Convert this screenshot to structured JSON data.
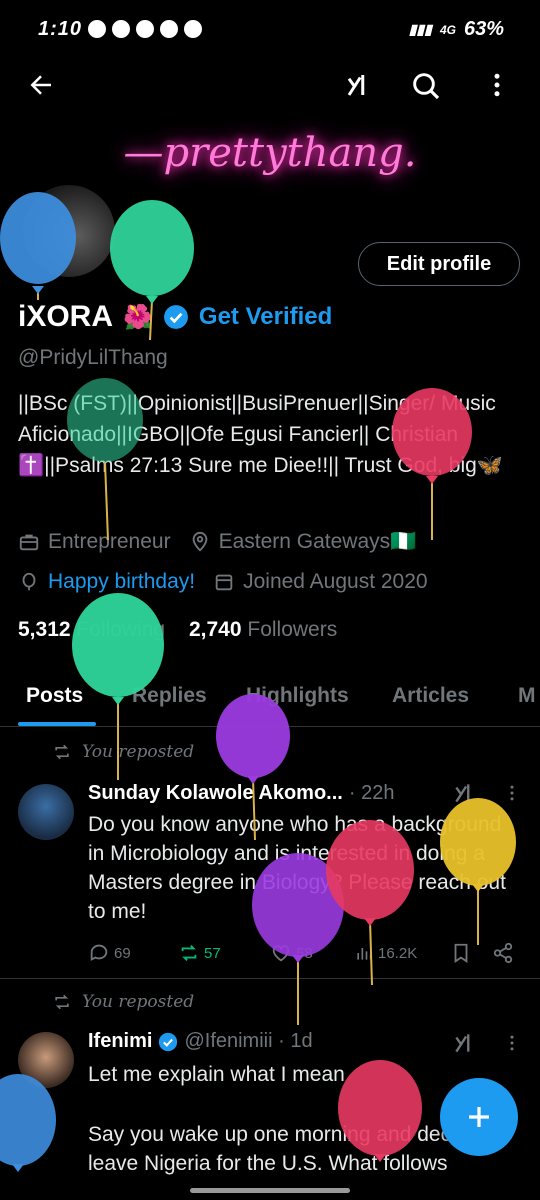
{
  "status_bar": {
    "time": "1:10",
    "battery": "63%",
    "network": "4G"
  },
  "header": {
    "banner_text": "—prettythang."
  },
  "profile": {
    "edit_label": "Edit profile",
    "name": "iXORA",
    "name_emoji": "🌺",
    "get_verified": "Get Verified",
    "handle": "@PridyLilThang",
    "bio": "||BSc (FST)||Opinionist||BusiPrenuer||Singer/ Music Aficionado||IGBO||Ofe Egusi Fancier|| Christian ✝️||Psalms 27:13 Sure me Diee!!|| Trust God, big🦋",
    "occupation": "Entrepreneur",
    "location": "Eastern Gateways🇳🇬",
    "birthday": "Happy birthday!",
    "joined": "Joined August 2020",
    "following_count": "5,312",
    "following_label": "Following",
    "followers_count": "2,740",
    "followers_label": "Followers"
  },
  "tabs": [
    "Posts",
    "Replies",
    "Highlights",
    "Articles",
    "M"
  ],
  "posts": [
    {
      "repost_label": "You reposted",
      "author": "Sunday Kolawole Akomo...",
      "meta": "· 22h",
      "text": "Do you know anyone who has a background in Microbiology and is interested in doing a Masters degree in Biology? Please reach out to me!",
      "replies": "69",
      "reposts": "57",
      "likes": "58",
      "views": "16.2K"
    },
    {
      "repost_label": "You reposted",
      "author": "Ifenimi",
      "meta": "@Ifenimiii · 1d",
      "text_line1": "Let me explain what I mean",
      "text_line2": "Say you wake up one morning and decide to leave Nigeria for the U.S. What follows"
    }
  ],
  "colors": {
    "accent": "#1d9bf0",
    "repost_green": "#00ba7c",
    "banner_pink": "#ff7ad9"
  }
}
